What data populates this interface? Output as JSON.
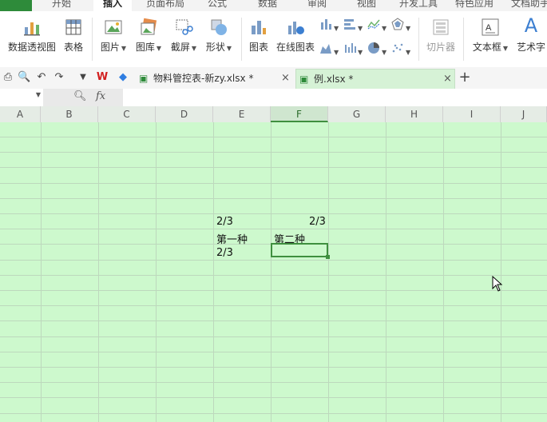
{
  "menu_tabs": [
    "开始",
    "插入",
    "页面布局",
    "公式",
    "数据",
    "审阅",
    "视图",
    "开发工具",
    "特色应用",
    "文档助手"
  ],
  "menu_active": "插入",
  "ribbon": {
    "pivot": "数据透视图",
    "table": "表格",
    "picture": "图片",
    "gallery": "图库",
    "screenshot": "截屏",
    "shapes": "形状",
    "chart": "图表",
    "online_chart": "在线图表",
    "slicer": "切片器",
    "textbox": "文本框",
    "wordart": "艺术字"
  },
  "tabs": {
    "doc1": "物料管控表-新zy.xlsx *",
    "doc2": "例.xlsx *",
    "close": "×",
    "add": "+"
  },
  "formula": {
    "fx": "fx",
    "name_value": ""
  },
  "columns": [
    "A",
    "B",
    "C",
    "D",
    "E",
    "F",
    "G",
    "H",
    "I",
    "J"
  ],
  "selected_column": "F",
  "cells": {
    "e6": "2/3",
    "f6": "2/3",
    "e7": "第一种",
    "f7": "第二种",
    "e8": "2/3"
  },
  "colors": {
    "sheet_bg": "#cdf9cd",
    "accent": "#3f8f3f"
  }
}
